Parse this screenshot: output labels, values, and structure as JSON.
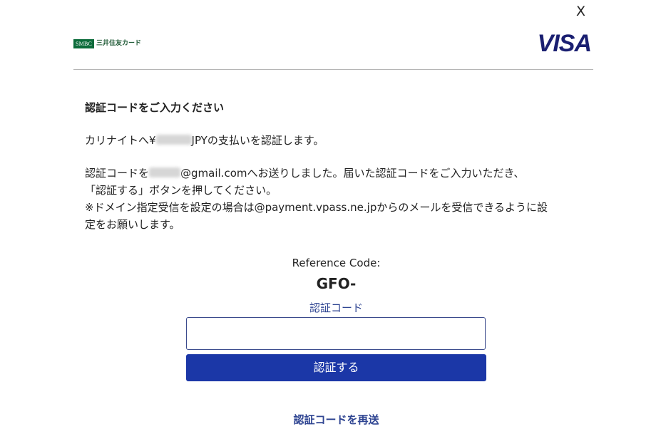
{
  "close_label": "X",
  "header": {
    "issuer_logo_box": "SMBC",
    "issuer_logo_text": "三井住友カード",
    "network_logo": "VISA"
  },
  "content": {
    "heading": "認証コードをご入力ください",
    "para1_prefix": "カリナイトへ¥",
    "para1_suffix": "JPYの支払いを認証します。",
    "para2_line1_prefix": "認証コードを",
    "para2_line1_suffix": "@gmail.comへお送りしました。届いた認証コードをご入力いただき、",
    "para2_line2": "「認証する」ボタンを押してください。",
    "para2_line3": "※ドメイン指定受信を設定の場合は@payment.vpass.ne.jpからのメールを受信できるように設",
    "para2_line4": "定をお願いします。"
  },
  "form": {
    "reference_label": "Reference Code:",
    "reference_code": "GFO-",
    "code_label": "認証コード",
    "code_value": "",
    "submit_label": "認証する",
    "resend_label": "認証コードを再送"
  },
  "colors": {
    "visa_blue": "#1a1f71",
    "button_blue": "#1b37a7",
    "link_blue": "#2f4592",
    "smbc_green": "#0b6b3a"
  }
}
